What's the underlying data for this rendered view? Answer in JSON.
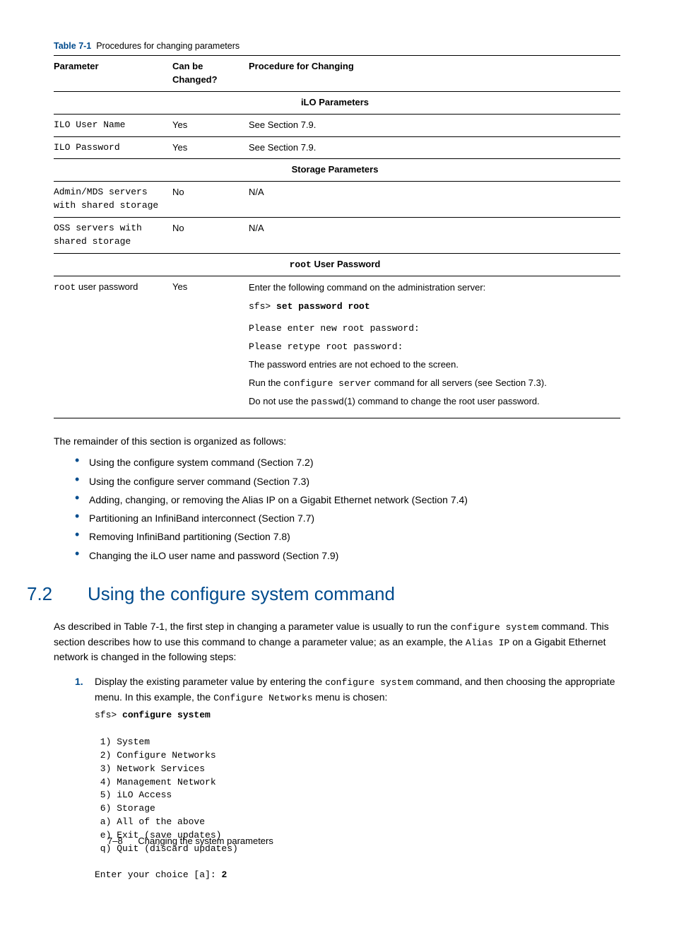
{
  "tableCaption": {
    "label": "Table 7-1",
    "text": "Procedures for changing parameters"
  },
  "headers": {
    "param": "Parameter",
    "can": "Can be Changed?",
    "proc": "Procedure for Changing"
  },
  "sections": {
    "ilo": "iLO Parameters",
    "storage": "Storage Parameters",
    "root": {
      "prefix": "root",
      "suffix": " User Password"
    }
  },
  "rows": {
    "iloUser": {
      "param": "ILO User Name",
      "can": "Yes",
      "proc": "See Section 7.9."
    },
    "iloPass": {
      "param": "ILO Password",
      "can": "Yes",
      "proc": "See Section 7.9."
    },
    "adminMds": {
      "param": "Admin/MDS servers with shared storage",
      "can": "No",
      "proc": "N/A"
    },
    "oss": {
      "param": "OSS servers with shared storage",
      "can": "No",
      "proc": "N/A"
    },
    "rootRow": {
      "paramPrefix": "root",
      "paramSuffix": " user password",
      "can": "Yes",
      "l1": "Enter the following command on the administration server:",
      "l2a": "sfs> ",
      "l2b": "set password root",
      "l3": "Please enter new root password:",
      "l4": "Please retype root password:",
      "l5": "The password entries are not echoed to the screen.",
      "l6a": "Run the ",
      "l6b": "configure server",
      "l6c": " command for all servers (see Section 7.3).",
      "l7a": "Do not use the ",
      "l7b": "passwd",
      "l7c": "(1) command to change the root user password."
    }
  },
  "introLine": "The remainder of this section is organized as follows:",
  "bullets": [
    "Using the configure system command (Section 7.2)",
    "Using the configure server command (Section 7.3)",
    "Adding, changing, or removing the Alias IP on a Gigabit Ethernet network (Section 7.4)",
    "Partitioning an InfiniBand interconnect (Section 7.7)",
    "Removing InfiniBand partitioning (Section 7.8)",
    "Changing the iLO user name and password (Section 7.9)"
  ],
  "section": {
    "num": "7.2",
    "title": "Using the configure system command"
  },
  "para1": {
    "a": "As described in Table 7-1, the first step in changing a parameter value is usually to run the ",
    "b": "configure system",
    "c": " command. This section describes how to use this command to change a parameter value; as an example, the ",
    "d": "Alias IP",
    "e": " on a Gigabit Ethernet network is changed in the following steps:"
  },
  "step1": {
    "num": "1.",
    "a": "Display the existing parameter value by entering the ",
    "b": "configure system",
    "c": " command, and then choosing the appropriate menu. In this example, the ",
    "d": "Configure Networks",
    "e": " menu is chosen:",
    "cmdPrompt": "sfs> ",
    "cmd": "configure system",
    "menu": " 1) System\n 2) Configure Networks\n 3) Network Services\n 4) Management Network\n 5) iLO Access\n 6) Storage\n a) All of the above\n e) Exit (save updates)\n q) Quit (discard updates)",
    "choicePrompt": "Enter your choice [a]: ",
    "choice": "2"
  },
  "chart_data": {
    "type": "table",
    "title": "Table 7-1 Procedures for changing parameters",
    "columns": [
      "Parameter",
      "Can be Changed?",
      "Procedure for Changing"
    ],
    "groups": [
      {
        "name": "iLO Parameters",
        "rows": [
          [
            "ILO User Name",
            "Yes",
            "See Section 7.9."
          ],
          [
            "ILO Password",
            "Yes",
            "See Section 7.9."
          ]
        ]
      },
      {
        "name": "Storage Parameters",
        "rows": [
          [
            "Admin/MDS servers with shared storage",
            "No",
            "N/A"
          ],
          [
            "OSS servers with shared storage",
            "No",
            "N/A"
          ]
        ]
      },
      {
        "name": "root User Password",
        "rows": [
          [
            "root user password",
            "Yes",
            "Enter the following command on the administration server: sfs> set password root. Please enter new root password: Please retype root password: The password entries are not echoed to the screen. Run the configure server command for all servers (see Section 7.3). Do not use the passwd(1) command to change the root user password."
          ]
        ]
      }
    ]
  },
  "footer": {
    "page": "7–8",
    "title": "Changing the system parameters"
  }
}
